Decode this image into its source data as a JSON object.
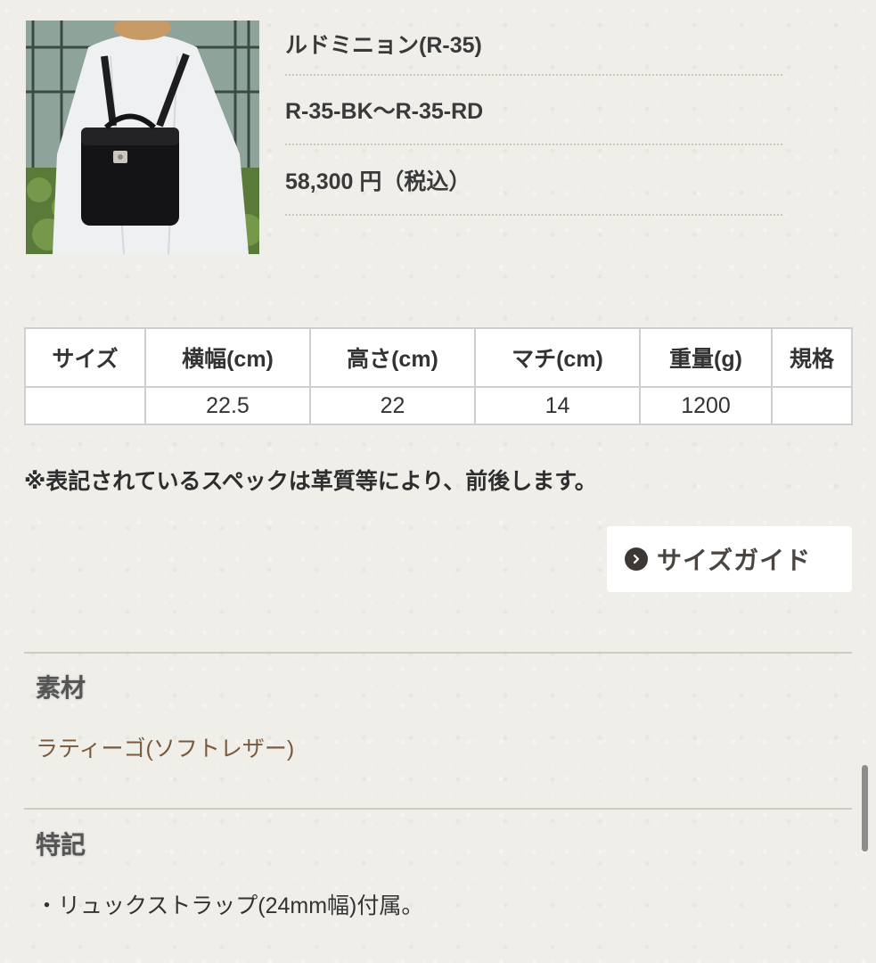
{
  "product": {
    "name": "ルドミニョン(R-35)",
    "code": "R-35-BK〜R-35-RD",
    "price": "58,300 円（税込）"
  },
  "spec_table": {
    "headers": [
      "サイズ",
      "横幅(cm)",
      "高さ(cm)",
      "マチ(cm)",
      "重量(g)",
      "規格"
    ],
    "row": [
      "",
      "22.5",
      "22",
      "14",
      "1200",
      ""
    ]
  },
  "note": "※表記されているスペックは革質等により、前後します。",
  "size_guide": {
    "label": "サイズガイド",
    "icon": "chevron-right-circle-icon"
  },
  "material": {
    "heading": "素材",
    "value": "ラティーゴ(ソフトレザー)"
  },
  "features": {
    "heading": "特記",
    "value": "・リュックストラップ(24mm幅)付属。"
  },
  "colors": {
    "background": "#f0eee9",
    "material_text": "#7a5a3e",
    "button_bg": "#ffffff"
  }
}
